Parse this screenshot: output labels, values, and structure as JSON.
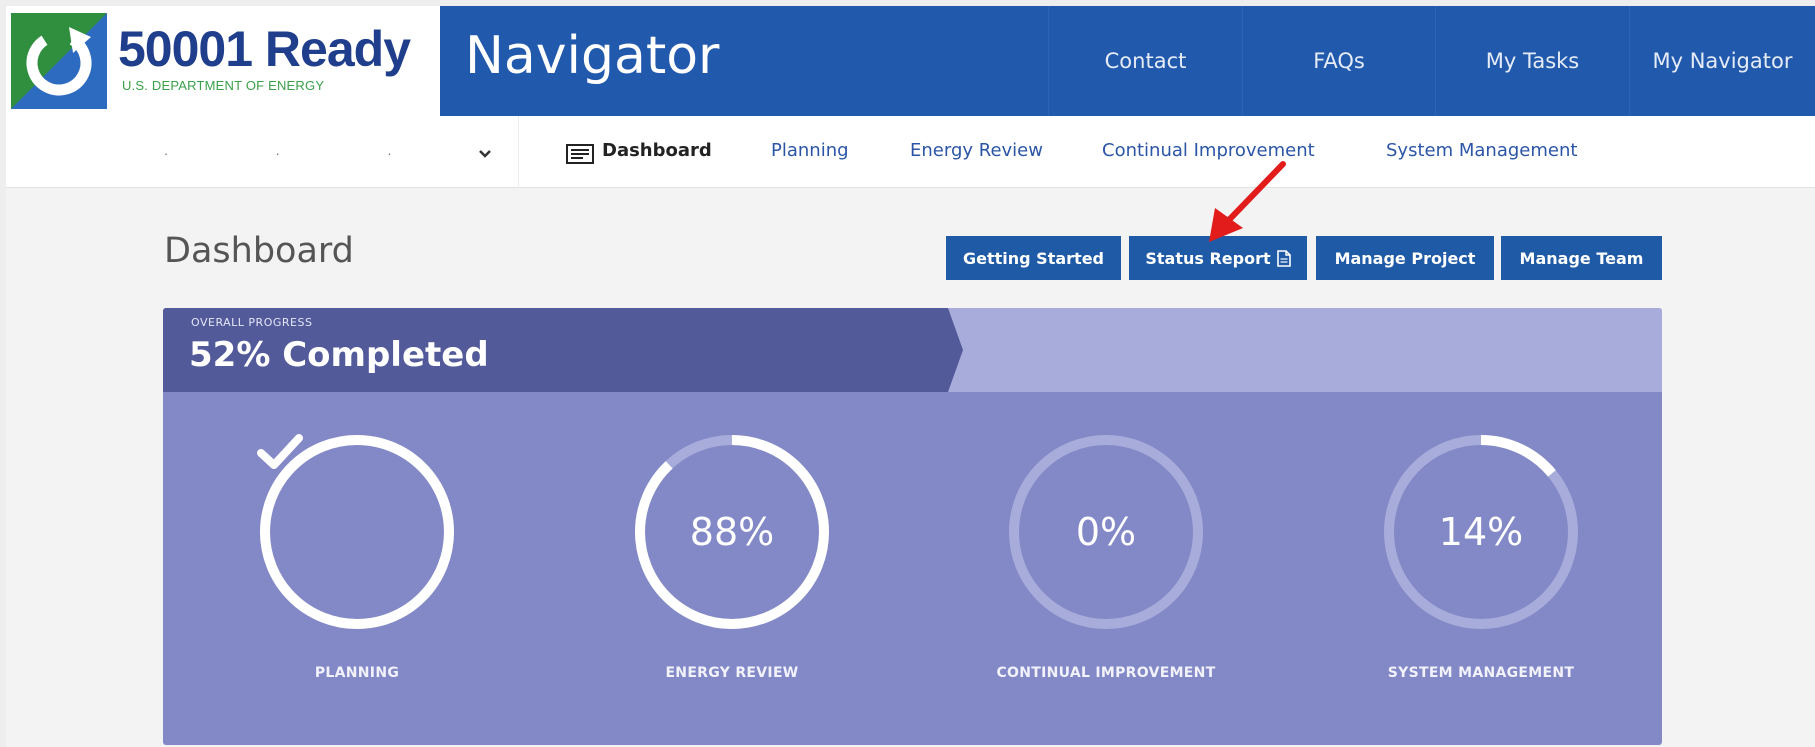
{
  "brand": {
    "name": "50001 Ready",
    "subtitle": "U.S. DEPARTMENT OF ENERGY",
    "logo_icon": "refresh-arrow-icon",
    "colors": {
      "blue": "#2159ad",
      "green": "#3aa04a"
    }
  },
  "header": {
    "app_title": "Navigator",
    "nav": [
      {
        "label": "Contact"
      },
      {
        "label": "FAQs"
      },
      {
        "label": "My Tasks"
      },
      {
        "label": "My Navigator"
      }
    ]
  },
  "subnav": {
    "project_name": ". . .",
    "items": [
      {
        "label": "Dashboard",
        "icon": "dashboard-icon",
        "active": true
      },
      {
        "label": "Planning"
      },
      {
        "label": "Energy Review"
      },
      {
        "label": "Continual Improvement"
      },
      {
        "label": "System Management"
      }
    ]
  },
  "page": {
    "title": "Dashboard",
    "actions": [
      {
        "label": "Getting Started"
      },
      {
        "label": "Status Report",
        "icon": "document-icon"
      },
      {
        "label": "Manage Project"
      },
      {
        "label": "Manage Team"
      }
    ],
    "annotation": {
      "icon": "red-arrow-icon",
      "color": "#e21b1b"
    }
  },
  "progress": {
    "overall_label": "OVERALL PROGRESS",
    "overall_value": "52% Completed",
    "colors": {
      "card": "#8389c7",
      "banner": "#525a9a",
      "track": "#a8acdb"
    },
    "sections": [
      {
        "label": "PLANNING",
        "value": "",
        "percent": 100,
        "icon": "checkmark-icon"
      },
      {
        "label": "ENERGY REVIEW",
        "value": "88%",
        "percent": 88
      },
      {
        "label": "CONTINUAL IMPROVEMENT",
        "value": "0%",
        "percent": 0
      },
      {
        "label": "SYSTEM MANAGEMENT",
        "value": "14%",
        "percent": 14
      }
    ]
  }
}
